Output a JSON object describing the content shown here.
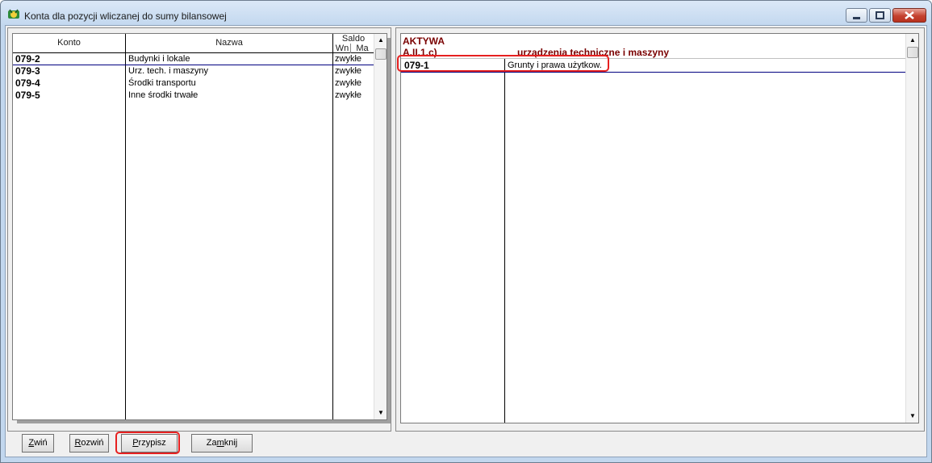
{
  "window": {
    "title": "Konta dla pozycji wliczanej do sumy bilansowej",
    "controls": [
      "minimize",
      "maximize",
      "close"
    ]
  },
  "left_grid": {
    "headers": {
      "konto": "Konto",
      "nazwa": "Nazwa",
      "saldo": "Saldo",
      "wn": "Wn",
      "ma": "Ma"
    },
    "rows": [
      {
        "konto": "079-2",
        "nazwa": "Budynki i lokale",
        "saldo": "zwykłe"
      },
      {
        "konto": "079-3",
        "nazwa": "Urz. tech. i maszyny",
        "saldo": "zwykłe"
      },
      {
        "konto": "079-4",
        "nazwa": "Środki transportu",
        "saldo": "zwykłe"
      },
      {
        "konto": "079-5",
        "nazwa": "Inne środki trwałe",
        "saldo": "zwykłe"
      }
    ]
  },
  "right_grid": {
    "section": "AKTYWA",
    "position_code": "A.II.1.c)",
    "position_name": "urządzenia techniczne i maszyny",
    "rows": [
      {
        "konto": "079-1",
        "nazwa": "Grunty i prawa użytkow."
      }
    ]
  },
  "buttons": {
    "zwin": {
      "mnemonic": "Z",
      "rest": "wiń"
    },
    "rozwin": {
      "mnemonic": "R",
      "rest": "ozwiń"
    },
    "przypisz": {
      "mnemonic": "P",
      "rest": "rzypisz"
    },
    "zamknij_pre": "Za",
    "zamknij_mnemonic": "m",
    "zamknij_post": "knij"
  },
  "colors": {
    "accent_red": "#7a0000",
    "annotation_red": "#e62020",
    "row_underline": "#000080"
  }
}
